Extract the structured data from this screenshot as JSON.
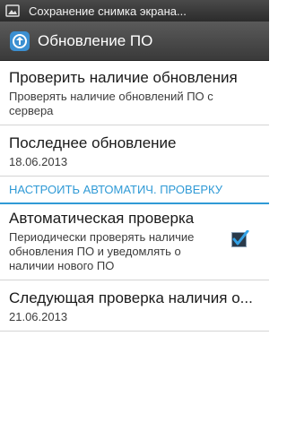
{
  "status_bar": {
    "notification_text": "Сохранение снимка экрана...",
    "icon": "image-icon"
  },
  "action_bar": {
    "app_icon": "software-update-icon",
    "title": "Обновление ПО"
  },
  "items": {
    "check_updates": {
      "title": "Проверить наличие обновления",
      "summary": "Проверять наличие обновлений ПО с сервера"
    },
    "last_update": {
      "title": "Последнее обновление",
      "summary": "18.06.2013"
    },
    "category": {
      "label": "НАСТРОИТЬ АВТОМАТИЧ. ПРОВЕРКУ"
    },
    "auto_check": {
      "title": "Автоматическая проверка",
      "summary": "Периодически проверять наличие обновления ПО и уведомлять о наличии нового ПО",
      "checked": true
    },
    "next_check": {
      "title": "Следующая проверка наличия о...",
      "summary": "21.06.2013"
    }
  },
  "colors": {
    "accent": "#2f9ad6",
    "bar_dark": "#3a3a3a"
  }
}
